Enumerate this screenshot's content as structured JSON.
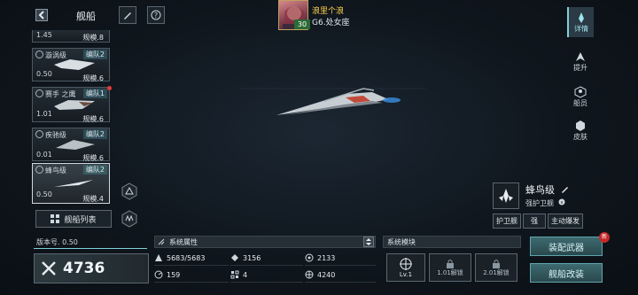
{
  "header": {
    "title": "舰船"
  },
  "player": {
    "name": "浪里个浪",
    "sub": "G6.处女座",
    "level": "30"
  },
  "ships": [
    {
      "name": "",
      "value": "1.45",
      "rank": "规模.8",
      "tag": ""
    },
    {
      "name": "漩涡级",
      "value": "0.50",
      "rank": "规模.6",
      "tag": "编队2"
    },
    {
      "name": "赛手 之鹰",
      "value": "1.01",
      "rank": "规模.6",
      "tag": "编队1"
    },
    {
      "name": "疾驰级",
      "value": "0.01",
      "rank": "规模.6",
      "tag": "编队2"
    },
    {
      "name": "蜂鸟级",
      "value": "0.50",
      "rank": "规模.4",
      "tag": "编队2"
    }
  ],
  "list_button": "舰船列表",
  "tabs": [
    {
      "label": "详情",
      "icon": "detail-icon",
      "active": true
    },
    {
      "label": "提升",
      "icon": "upgrade-icon",
      "active": false
    },
    {
      "label": "船员",
      "icon": "crew-icon",
      "active": false
    },
    {
      "label": "皮肤",
      "icon": "skin-icon",
      "active": false
    }
  ],
  "ship_info": {
    "name": "蜂鸟级",
    "type": "强护卫舰",
    "tags": [
      "护卫舰",
      "强",
      "主动爆发"
    ]
  },
  "version": "版本号. 0.50",
  "power": "4736",
  "attributes": {
    "title": "系统属性",
    "items": [
      {
        "icon": "hull-icon",
        "value": "5683/5683"
      },
      {
        "icon": "crew-icon",
        "value": "3156"
      },
      {
        "icon": "shield-icon",
        "value": "2133"
      },
      {
        "icon": "speed-icon",
        "value": "159"
      },
      {
        "icon": "grid-icon",
        "value": "4"
      },
      {
        "icon": "target-icon",
        "value": "4240"
      }
    ]
  },
  "modules": {
    "title": "系统模块",
    "slots": [
      {
        "label": "Lv.1"
      },
      {
        "label": "1.01解锁"
      },
      {
        "label": "2.01解锁"
      }
    ]
  },
  "actions": {
    "equip": "装配武器",
    "refit": "舰船改装",
    "badge": "新"
  }
}
